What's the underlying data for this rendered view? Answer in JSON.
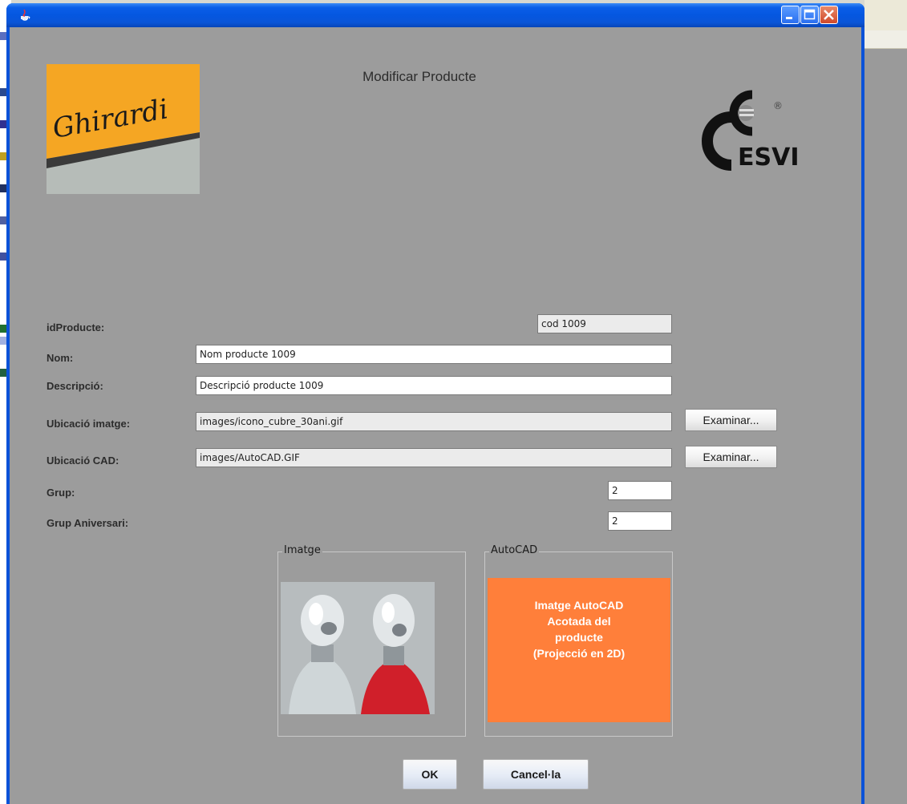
{
  "window": {
    "title": ""
  },
  "header": {
    "title": "Modificar Producte",
    "left_logo_text": "Ghirardi",
    "right_logo_text": "ESVI",
    "right_logo_registered": "®"
  },
  "form": {
    "fields": [
      {
        "label": "idProducte:",
        "value": "cod 1009"
      },
      {
        "label": "Nom:",
        "value": "Nom producte 1009"
      },
      {
        "label": "Descripció:",
        "value": "Descripció producte 1009"
      },
      {
        "label": "Ubicació imatge:",
        "value": "images/icono_cubre_30ani.gif"
      },
      {
        "label": "Ubicació CAD:",
        "value": "images/AutoCAD.GIF"
      },
      {
        "label": "Grup:",
        "value": "2"
      },
      {
        "label": "Grup Aniversari:",
        "value": "2"
      }
    ],
    "browse_label": "Examinar..."
  },
  "panels": {
    "image_title": "Imatge",
    "autocad_title": "AutoCAD",
    "autocad_lines": [
      "Imatge AutoCAD",
      "Acotada del",
      "producte",
      "(Projecció en 2D)"
    ]
  },
  "buttons": {
    "ok": "OK",
    "cancel": "Cancel·la"
  },
  "colors": {
    "background": "#9c9c9c",
    "autocad_box": "#ff7f3a",
    "logo_yellow": "#f5a623",
    "titlebar": "#0557e0"
  }
}
